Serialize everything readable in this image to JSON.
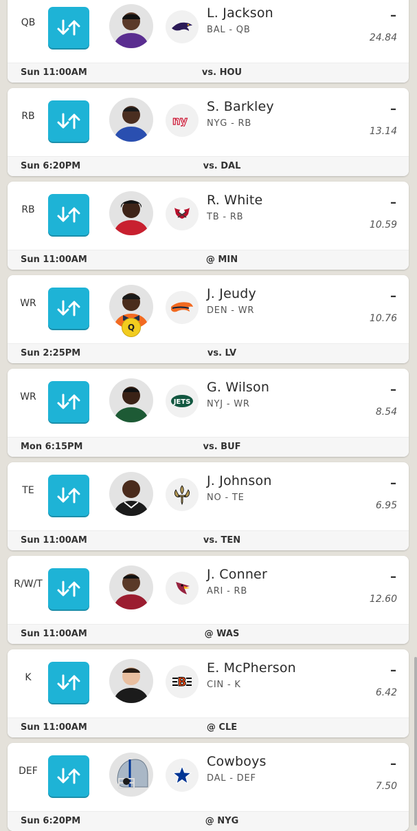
{
  "colors": {
    "accent": "#1eb3d6",
    "background": "#e4e1da",
    "questionable": "#f2cc1f"
  },
  "roster": [
    {
      "pos": "QB",
      "name": "L. Jackson",
      "meta": "BAL - QB",
      "dash": "–",
      "proj": "24.84",
      "time": "Sun 11:00AM",
      "opp": "vs. HOU",
      "team_logo": "ravens-logo",
      "jersey": "#5a2d90",
      "skin": "#5b3a29",
      "status": ""
    },
    {
      "pos": "RB",
      "name": "S. Barkley",
      "meta": "NYG - RB",
      "dash": "–",
      "proj": "13.14",
      "time": "Sun 6:20PM",
      "opp": "vs. DAL",
      "team_logo": "giants-logo",
      "jersey": "#2a4fb0",
      "skin": "#4a2e20",
      "status": ""
    },
    {
      "pos": "RB",
      "name": "R. White",
      "meta": "TB - RB",
      "dash": "–",
      "proj": "10.59",
      "time": "Sun 11:00AM",
      "opp": "@ MIN",
      "team_logo": "buccaneers-logo",
      "jersey": "#c8202f",
      "skin": "#3e2418",
      "status": ""
    },
    {
      "pos": "WR",
      "name": "J. Jeudy",
      "meta": "DEN - WR",
      "dash": "–",
      "proj": "10.76",
      "time": "Sun 2:25PM",
      "opp": "vs. LV",
      "team_logo": "broncos-logo",
      "jersey": "#f26a21",
      "skin": "#4a2c1c",
      "status": "Q"
    },
    {
      "pos": "WR",
      "name": "G. Wilson",
      "meta": "NYJ - WR",
      "dash": "–",
      "proj": "8.54",
      "time": "Mon 6:15PM",
      "opp": "vs. BUF",
      "team_logo": "jets-logo",
      "jersey": "#1d5a35",
      "skin": "#3a2216",
      "status": ""
    },
    {
      "pos": "TE",
      "name": "J. Johnson",
      "meta": "NO - TE",
      "dash": "–",
      "proj": "6.95",
      "time": "Sun 11:00AM",
      "opp": "vs. TEN",
      "team_logo": "saints-logo",
      "jersey": "#1b1b1b",
      "skin": "#4a2b1c",
      "status": ""
    },
    {
      "pos": "R/W/T",
      "name": "J. Conner",
      "meta": "ARI - RB",
      "dash": "–",
      "proj": "12.60",
      "time": "Sun 11:00AM",
      "opp": "@ WAS",
      "team_logo": "cardinals-logo",
      "jersey": "#9b1d30",
      "skin": "#5a3a28",
      "status": ""
    },
    {
      "pos": "K",
      "name": "E. McPherson",
      "meta": "CIN - K",
      "dash": "–",
      "proj": "6.42",
      "time": "Sun 11:00AM",
      "opp": "@ CLE",
      "team_logo": "bengals-logo",
      "jersey": "#1b1b1b",
      "skin": "#e9bfa0",
      "status": ""
    },
    {
      "pos": "DEF",
      "name": "Cowboys",
      "meta": "DAL - DEF",
      "dash": "–",
      "proj": "7.50",
      "time": "Sun 6:20PM",
      "opp": "@ NYG",
      "team_logo": "cowboys-logo",
      "jersey": "#a9b7c6",
      "skin": "",
      "status": ""
    }
  ]
}
